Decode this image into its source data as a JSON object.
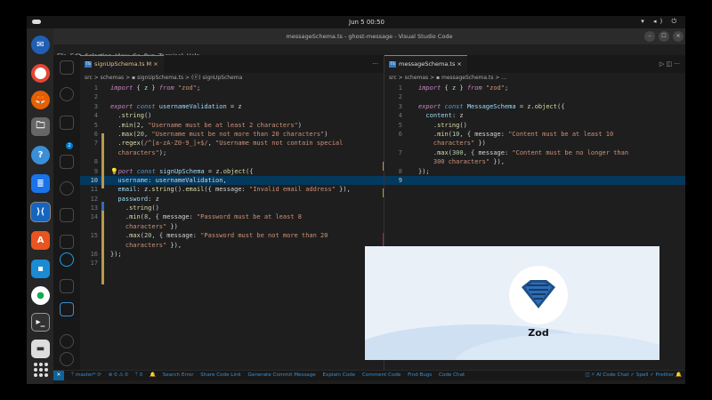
{
  "topbar": {
    "clock": "Jun 5  00:50",
    "tray": "▾ ◂) ⏻"
  },
  "window": {
    "title": "messageSchema.ts - ghost-message - Visual Studio Code",
    "min": "–",
    "max": "☐",
    "close": "×"
  },
  "menu": [
    "File",
    "Edit",
    "Selection",
    "View",
    "Go",
    "Run",
    "Terminal",
    "Help"
  ],
  "left_editor": {
    "tab": {
      "icon": "TS",
      "label": "signUpSchema.ts M ×"
    },
    "tab_actions": "···",
    "breadcrumb": "src > schemas > ▪ signUpSchema.ts > (ⓔ) signUpSchema",
    "lines": [
      {
        "n": "1",
        "html": "<span class=\"kw\">import</span><span class=\"pl\"> { </span><span class=\"id\">z</span><span class=\"pl\"> } </span><span class=\"kw\">from</span><span class=\"st\"> \"zod\"</span><span class=\"pl\">;</span>"
      },
      {
        "n": "2",
        "html": ""
      },
      {
        "n": "3",
        "html": "<span class=\"kw\">export</span><span class=\"kb\"> const</span><span class=\"id\"> usernameValidation</span><span class=\"pl\"> = z</span>"
      },
      {
        "n": "4",
        "html": "<span class=\"pl\">  .</span><span class=\"fn\">string</span><span class=\"pl\">()</span>"
      },
      {
        "n": "5",
        "html": "<span class=\"pl\">  .</span><span class=\"fn\">min</span><span class=\"pl\">(</span><span class=\"nm\">2</span><span class=\"pl\">, </span><span class=\"st\">\"Username must be at least 2 characters\"</span><span class=\"pl\">)</span>"
      },
      {
        "n": "6",
        "html": "<span class=\"pl\">  .</span><span class=\"fn\">max</span><span class=\"pl\">(</span><span class=\"nm\">20</span><span class=\"pl\">, </span><span class=\"st\">\"Username must be not more than 20 characters\"</span><span class=\"pl\">)</span>"
      },
      {
        "n": "7",
        "html": "<span class=\"pl\">  .</span><span class=\"fn\">regex</span><span class=\"pl\">(</span><span class=\"st\">/^[a-zA-Z0-9_]+$/</span><span class=\"pl\">, </span><span class=\"st\">\"Username must not contain special</span>"
      },
      {
        "n": "",
        "html": "<span class=\"st\">  characters\"</span><span class=\"pl\">);</span>"
      },
      {
        "n": "8",
        "html": ""
      },
      {
        "n": "9",
        "html": "<span class=\"bulb\">💡</span><span class=\"kw\">port</span><span class=\"kb\"> const</span><span class=\"id\"> signUpSchema</span><span class=\"pl\"> = z.</span><span class=\"fn\">object</span><span class=\"pl\">({</span>"
      },
      {
        "n": "10",
        "html": "<span class=\"id\">  username</span><span class=\"pl\">: usernameValidation,</span>",
        "cur": true
      },
      {
        "n": "11",
        "html": "<span class=\"id\">  email</span><span class=\"pl\">: z.</span><span class=\"fn\">string</span><span class=\"pl\">().</span><span class=\"fn\">email</span><span class=\"pl\">({ message: </span><span class=\"st\">\"Invalid email address\"</span><span class=\"pl\"> }),</span>"
      },
      {
        "n": "12",
        "html": "<span class=\"id\">  password</span><span class=\"pl\">: z</span>"
      },
      {
        "n": "13",
        "html": "<span class=\"pl\">    .</span><span class=\"fn\">string</span><span class=\"pl\">()</span>"
      },
      {
        "n": "14",
        "html": "<span class=\"pl\">    .</span><span class=\"fn\">min</span><span class=\"pl\">(</span><span class=\"nm\">8</span><span class=\"pl\">, { message: </span><span class=\"st\">\"Password must be at least 8</span>"
      },
      {
        "n": "",
        "html": "<span class=\"st\">    characters\"</span><span class=\"pl\"> })</span>"
      },
      {
        "n": "15",
        "html": "<span class=\"pl\">    .</span><span class=\"fn\">max</span><span class=\"pl\">(</span><span class=\"nm\">20</span><span class=\"pl\">, { message: </span><span class=\"st\">\"Password must be not more than 20</span>"
      },
      {
        "n": "",
        "html": "<span class=\"st\">    characters\"</span><span class=\"pl\"> }),</span>"
      },
      {
        "n": "16",
        "html": "<span class=\"pl\">});</span>"
      },
      {
        "n": "17",
        "html": ""
      }
    ]
  },
  "right_editor": {
    "tab": {
      "icon": "TS",
      "label": "messageSchema.ts ×"
    },
    "tab_actions": "▷  ◫  ···",
    "breadcrumb": "src > schemas > ▪ messageSchema.ts > ...",
    "lines": [
      {
        "n": "1",
        "html": "<span class=\"kw\">import</span><span class=\"pl\"> { </span><span class=\"id\">z</span><span class=\"pl\"> } </span><span class=\"kw\">from</span><span class=\"st\"> \"zod\"</span><span class=\"pl\">;</span>"
      },
      {
        "n": "2",
        "html": ""
      },
      {
        "n": "3",
        "html": "<span class=\"kw\">export</span><span class=\"kb\"> const</span><span class=\"id\"> MessageSchema</span><span class=\"pl\"> = z.</span><span class=\"fn\">object</span><span class=\"pl\">({</span>"
      },
      {
        "n": "4",
        "html": "<span class=\"id\">  content</span><span class=\"pl\">: z</span>"
      },
      {
        "n": "5",
        "html": "<span class=\"pl\">    .</span><span class=\"fn\">string</span><span class=\"pl\">()</span>"
      },
      {
        "n": "6",
        "html": "<span class=\"pl\">    .</span><span class=\"fn\">min</span><span class=\"pl\">(</span><span class=\"nm\">10</span><span class=\"pl\">, { message: </span><span class=\"st\">\"Content must be at least 10</span>"
      },
      {
        "n": "",
        "html": "<span class=\"st\">    characters\"</span><span class=\"pl\"> })</span>"
      },
      {
        "n": "7",
        "html": "<span class=\"pl\">    .</span><span class=\"fn\">max</span><span class=\"pl\">(</span><span class=\"nm\">300</span><span class=\"pl\">, { message: </span><span class=\"st\">\"Content must be no longer than</span>"
      },
      {
        "n": "",
        "html": "<span class=\"st\">    300 characters\"</span><span class=\"pl\"> }),</span>"
      },
      {
        "n": "8",
        "html": "<span class=\"pl\">});</span>"
      },
      {
        "n": "9",
        "html": "",
        "cur": true
      }
    ]
  },
  "zod_image": {
    "wordmark": "Zod"
  },
  "statusbar": {
    "remote": "✕",
    "items": [
      "ᛘ master* ⟳",
      "⊗ 0 ⚠ 0",
      "ᛘ 0",
      "🔔",
      "Search Error",
      "Share Code Link",
      "Generate Commit Message",
      "Explain Code",
      "Comment Code",
      "Find Bugs",
      "Code Chat"
    ],
    "right": "◫   ⚡ AI Code Chat   ✓ Spell   ✓ Prettier   🔔"
  },
  "colors": {
    "accent": "#3794ff",
    "status_text": "#3b8ed0",
    "current_line": "#04395e"
  }
}
